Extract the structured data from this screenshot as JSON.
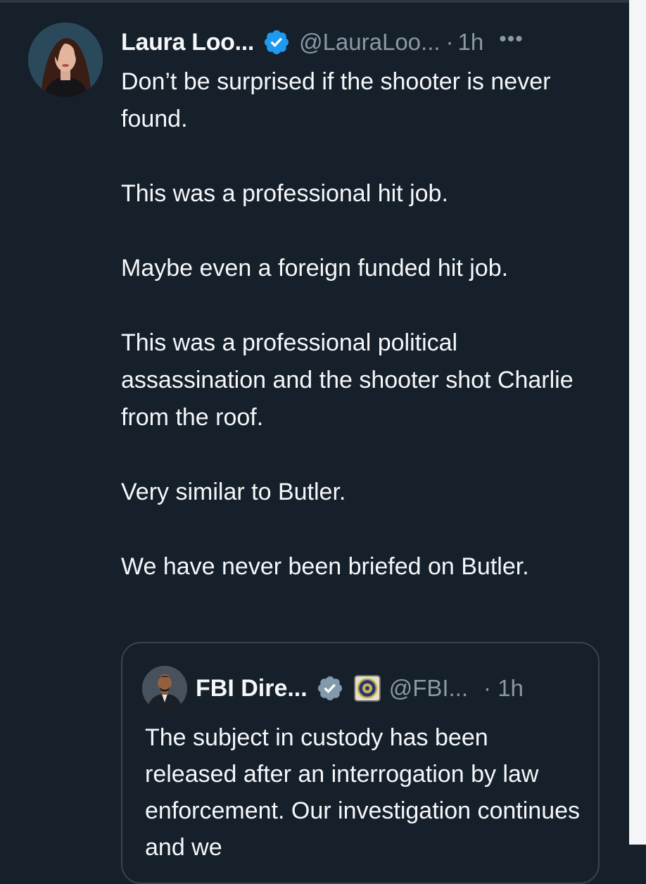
{
  "tweet": {
    "author_name": "Laura Loo...",
    "handle": "@LauraLoo...",
    "separator": "·",
    "time": "1h",
    "more_icon": "•••",
    "paragraphs": [
      "Don’t be surprised if the shooter is never found.",
      "This was a professional hit job.",
      "Maybe even a foreign funded hit job.",
      "This was a professional political assassination and the shooter shot Charlie from the roof.",
      "Very similar to Butler.",
      "We have never been briefed on Butler."
    ]
  },
  "quote": {
    "author_name": "FBI Dire...",
    "handle": "@FBI...",
    "time": "· 1h",
    "text": "The subject in custody has been released after an interrogation by law enforcement.  Our investigation continues and we"
  },
  "colors": {
    "background": "#15202b",
    "primary_text": "#f5f7f9",
    "secondary_text": "#8b98a5",
    "verified_blue": "#1d9bf0",
    "verified_gray": "#829aab",
    "quote_border": "#38444d"
  },
  "icons": {
    "verified": "verified-badge-icon",
    "gov_verified": "gray-verified-badge-icon",
    "affiliation": "fbi-seal-icon",
    "more": "more-options-icon"
  }
}
